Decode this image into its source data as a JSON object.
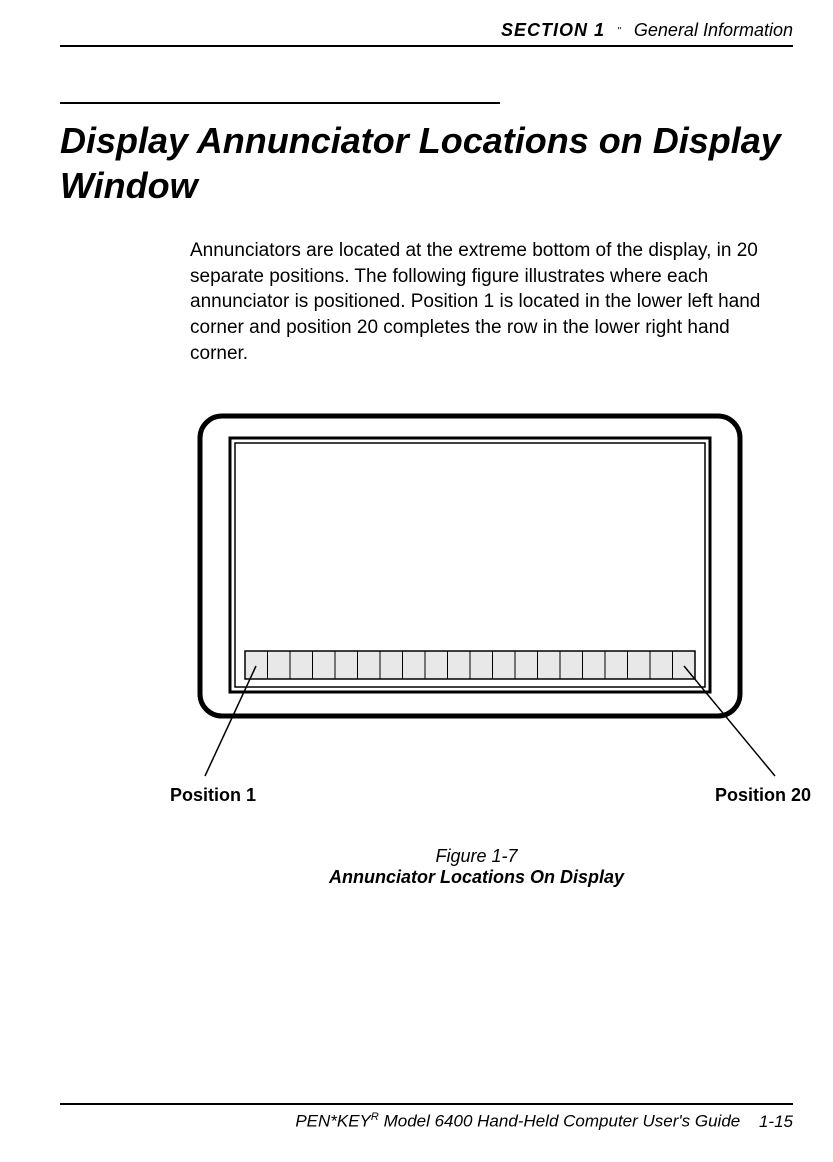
{
  "header": {
    "section": "SECTION 1",
    "bullet": "\"",
    "name": "General Information"
  },
  "title": "Display Annunciator Locations on Display Window",
  "body": "Annunciators are located at the extreme bottom of the display, in 20 separate positions.  The following figure illustrates where each annunciator is positioned.  Position 1 is located in the lower left hand corner and position 20 completes the row in the lower right hand corner.",
  "figure": {
    "label_left": "Position 1",
    "label_right": "Position 20",
    "caption_number": "Figure 1-7",
    "caption_title": "Annunciator Locations On Display",
    "annunciator_count": 20
  },
  "footer": {
    "brand_prefix": "PEN*KEY",
    "brand_sup": "R",
    "guide": " Model 6400 Hand-Held Computer User's Guide",
    "page": "1-15"
  }
}
